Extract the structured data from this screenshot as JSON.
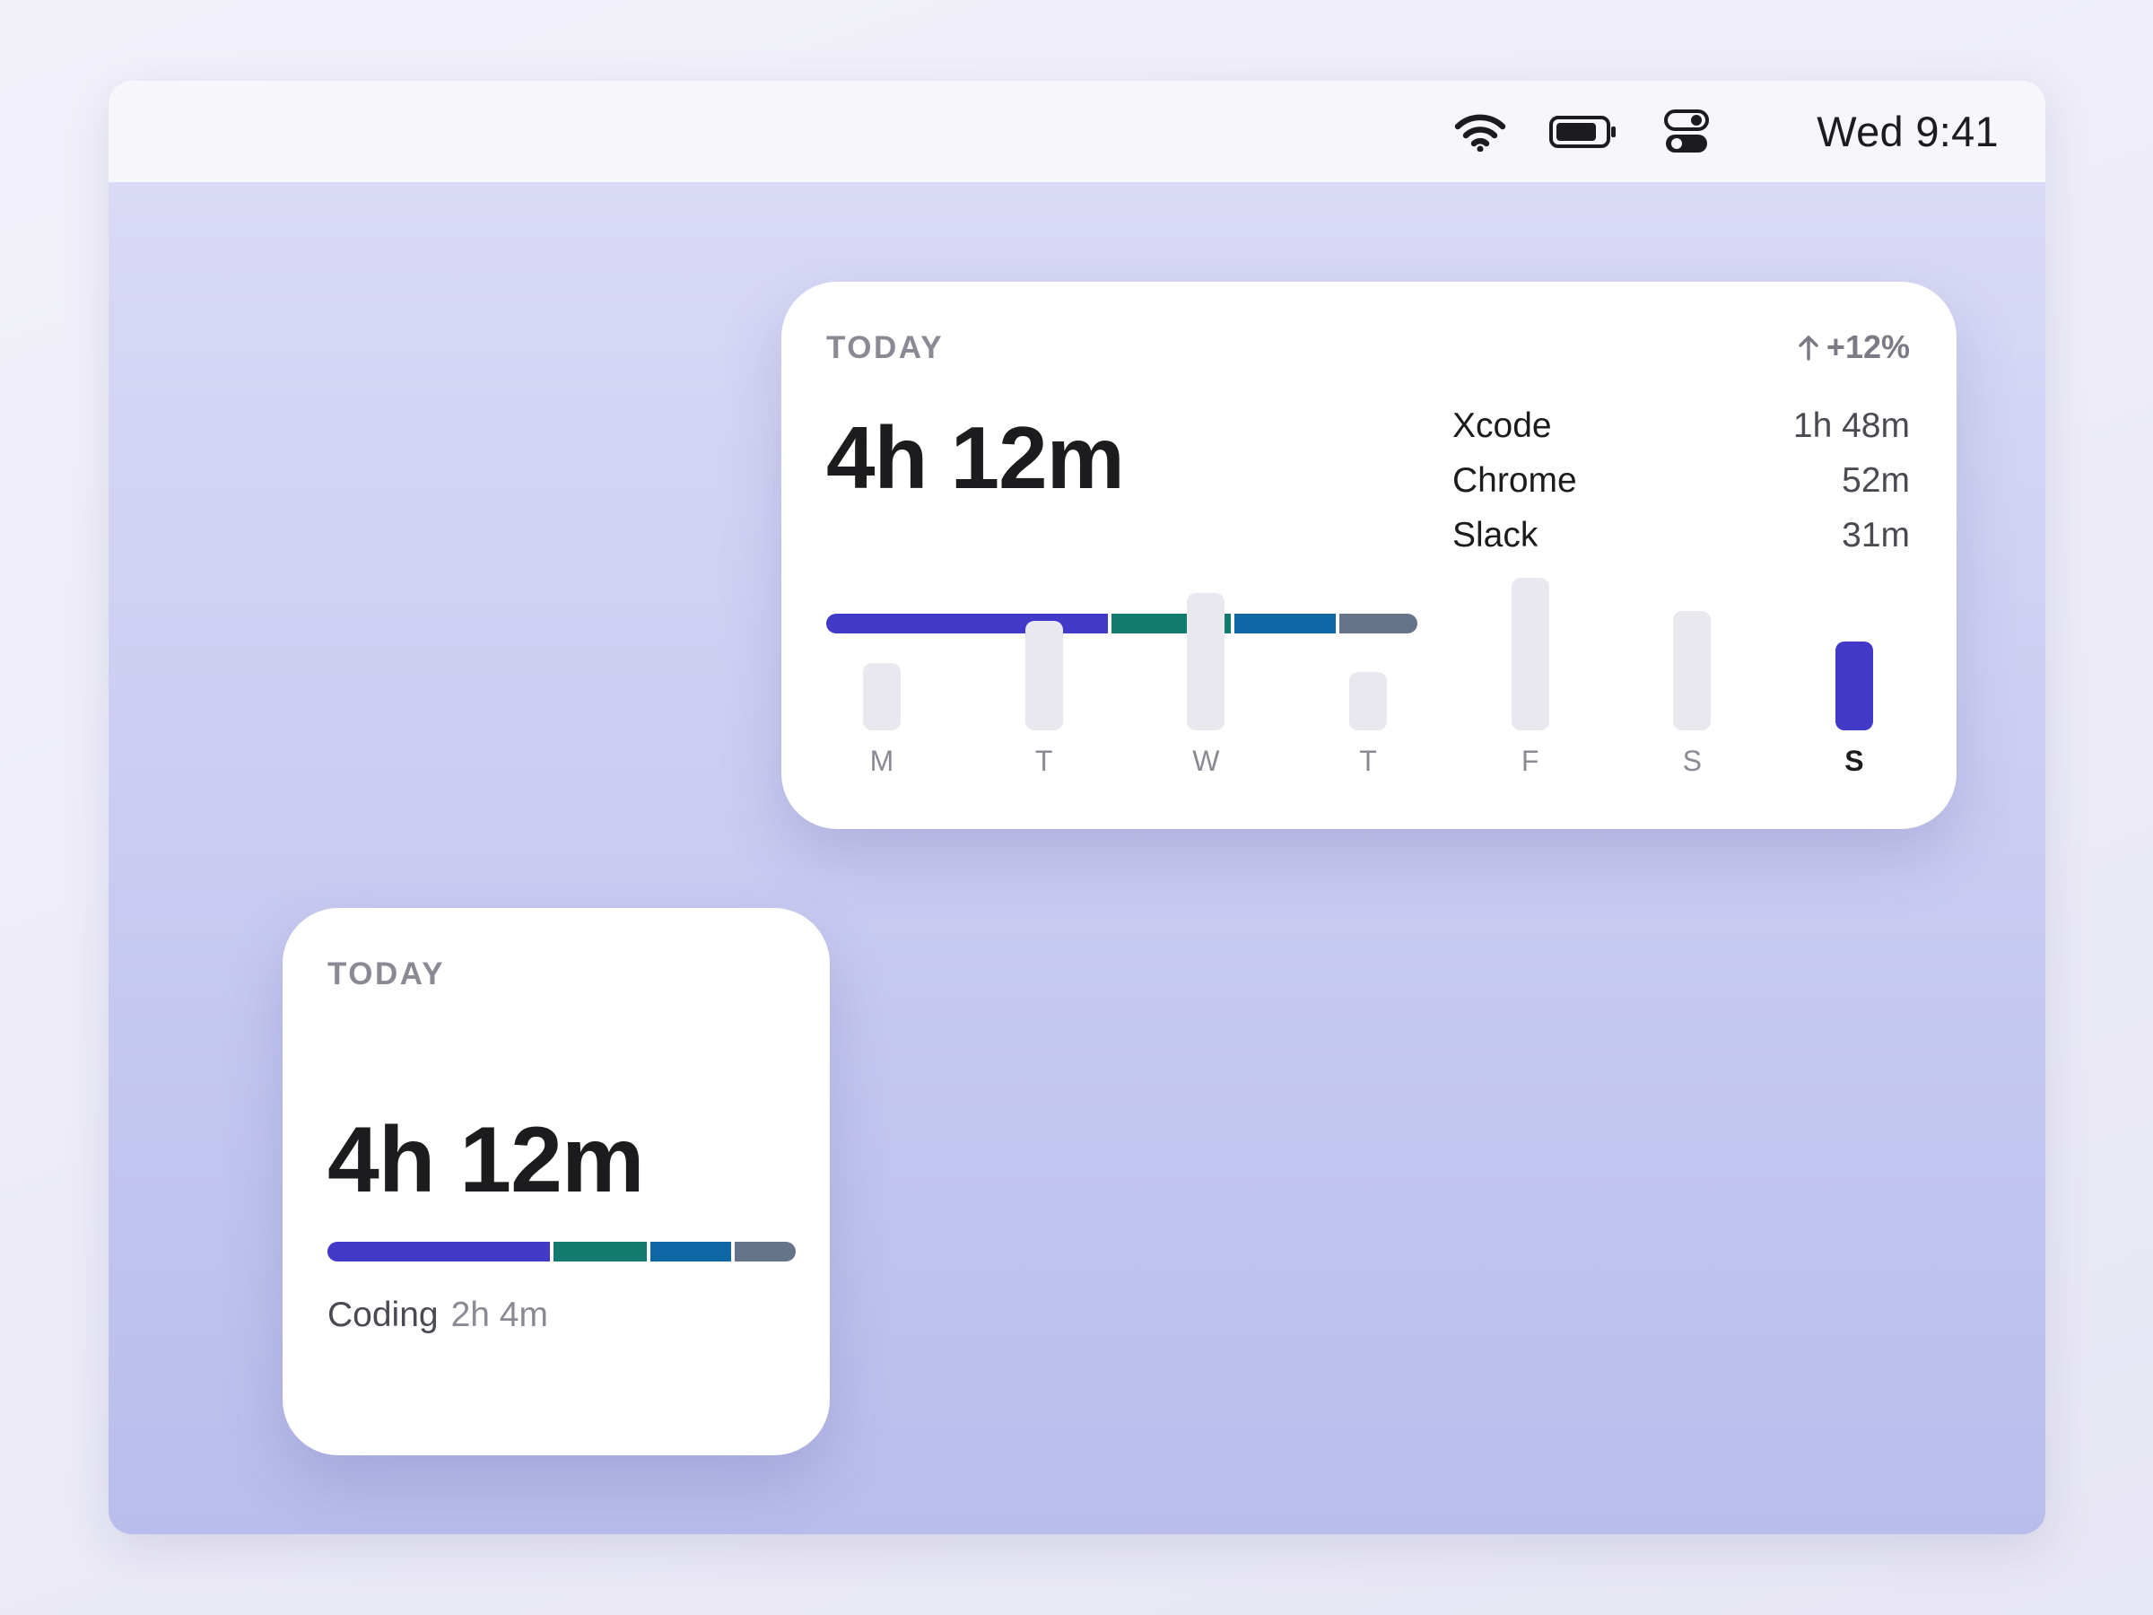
{
  "menubar": {
    "icons": [
      "wifi-icon",
      "battery-icon",
      "control-center-icon"
    ],
    "clock": "Wed 9:41"
  },
  "colors": {
    "accent": "#4339c8",
    "teal": "#127a6e",
    "blue": "#0f67a6",
    "slate": "#66748a",
    "inactive_bar": "#e9e8ee"
  },
  "large_widget": {
    "label": "TODAY",
    "trend": "+12%",
    "trend_icon": "arrow-up-icon",
    "total": "4h 12m",
    "apps": [
      {
        "name": "Xcode",
        "time": "1h 48m"
      },
      {
        "name": "Chrome",
        "time": "52m"
      },
      {
        "name": "Slack",
        "time": "31m"
      }
    ],
    "breakdown": [
      0.486,
      0.205,
      0.175,
      0.134
    ],
    "week": {
      "days": [
        "M",
        "T",
        "W",
        "T",
        "F",
        "S",
        "S"
      ],
      "levels": [
        0.44,
        0.72,
        0.9,
        0.38,
        1.0,
        0.78,
        0.58
      ],
      "active_index": 6
    }
  },
  "small_widget": {
    "label": "TODAY",
    "total": "4h 12m",
    "breakdown": [
      0.486,
      0.205,
      0.175,
      0.134
    ],
    "category": "Coding",
    "category_time": "2h 4m"
  }
}
